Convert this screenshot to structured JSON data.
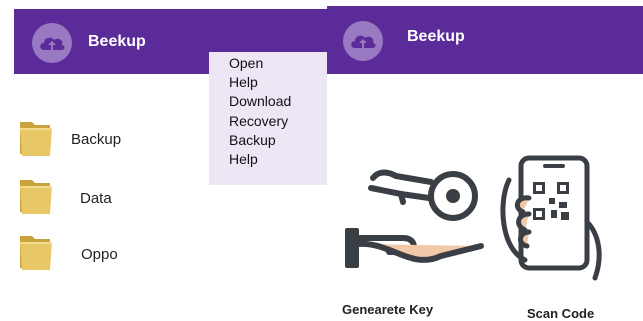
{
  "app": {
    "title": "Beekup",
    "icon": "cloud-upload-icon",
    "colors": {
      "header": "#5b2b9a",
      "logo_circle": "#9a79c3",
      "menu_bg": "#ece6f5",
      "folder": "#e8c765"
    }
  },
  "left_screen": {
    "menu": {
      "items": [
        {
          "label": "Open"
        },
        {
          "label": "Help"
        },
        {
          "label": "Download"
        },
        {
          "label": "Recovery"
        },
        {
          "label": "Backup"
        },
        {
          "label": "Help"
        }
      ]
    },
    "folders": [
      {
        "label": "Backup",
        "icon": "folder-icon"
      },
      {
        "label": "Data",
        "icon": "folder-icon"
      },
      {
        "label": "Oppo",
        "icon": "folder-icon"
      }
    ]
  },
  "right_screen": {
    "actions": [
      {
        "label": "Genearete Key",
        "icon": "key-hand-icon"
      },
      {
        "label": "Scan Code",
        "icon": "phone-qr-scan-icon"
      }
    ]
  }
}
